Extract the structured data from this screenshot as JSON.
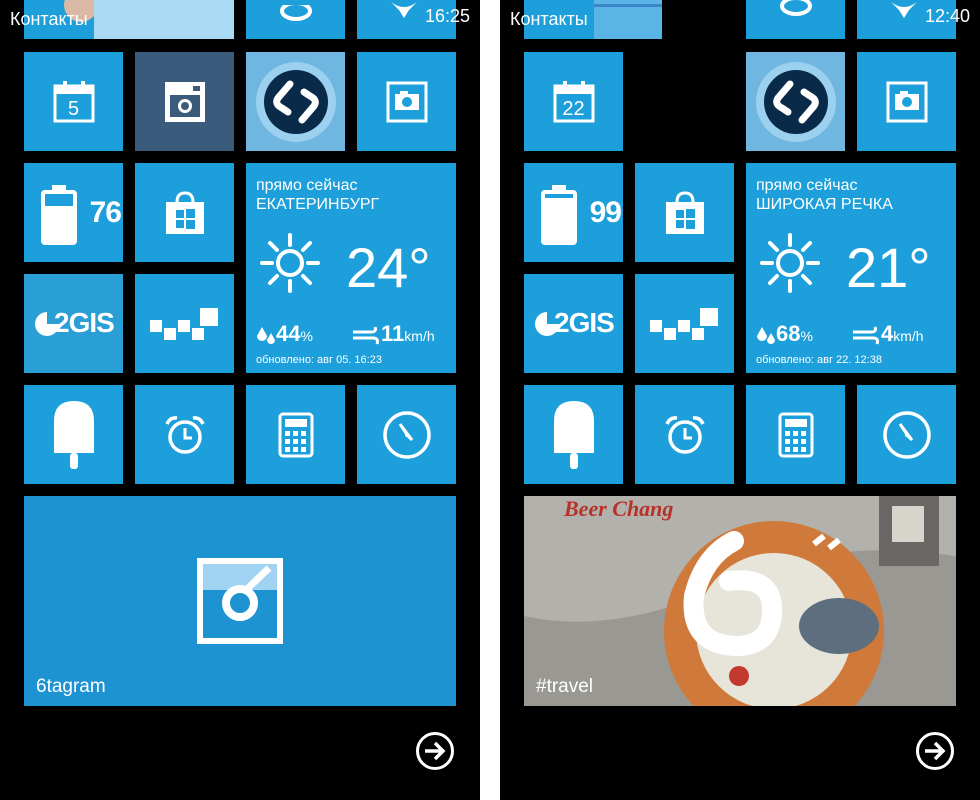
{
  "colors": {
    "tile": "#1c9fda",
    "tile_dark": "#1e93d1",
    "instagram_tile": "#3b5b7c",
    "background": "#000000"
  },
  "left": {
    "time": "16:25",
    "contacts_label": "Контакты",
    "calendar_day": "5",
    "battery_percent": "76",
    "gis_label": "2GIS",
    "weather": {
      "now_label": "прямо сейчас",
      "city": "ЕКАТЕРИНБУРГ",
      "temperature": "24°",
      "humidity_value": "44",
      "humidity_unit": "%",
      "wind_value": "11",
      "wind_unit": "km/h",
      "updated": "обновлено: авг 05. 16:23"
    },
    "big_tile_label": "6tagram"
  },
  "right": {
    "time": "12:40",
    "contacts_label": "Контакты",
    "calendar_day": "22",
    "battery_percent": "99",
    "gis_label": "2GIS",
    "weather": {
      "now_label": "прямо сейчас",
      "city": "ШИРОКАЯ РЕЧКА",
      "temperature": "21°",
      "humidity_value": "68",
      "humidity_unit": "%",
      "wind_value": "4",
      "wind_unit": "km/h",
      "updated": "обновлено: авг 22. 12:38"
    },
    "big_tile_label": "#travel",
    "photo_text": "Beer Chang"
  },
  "icons": [
    "avatar",
    "ie-icon",
    "bird-icon",
    "calendar-icon",
    "instagram-icon",
    "shazam-icon",
    "photos-icon",
    "battery-icon",
    "store-icon",
    "gis-icon",
    "taxi-icon",
    "sun-icon",
    "humidity-icon",
    "wind-icon",
    "popsicle-icon",
    "alarm-icon",
    "calculator-icon",
    "compass-icon",
    "6tagram-icon",
    "arrow-right-icon"
  ]
}
